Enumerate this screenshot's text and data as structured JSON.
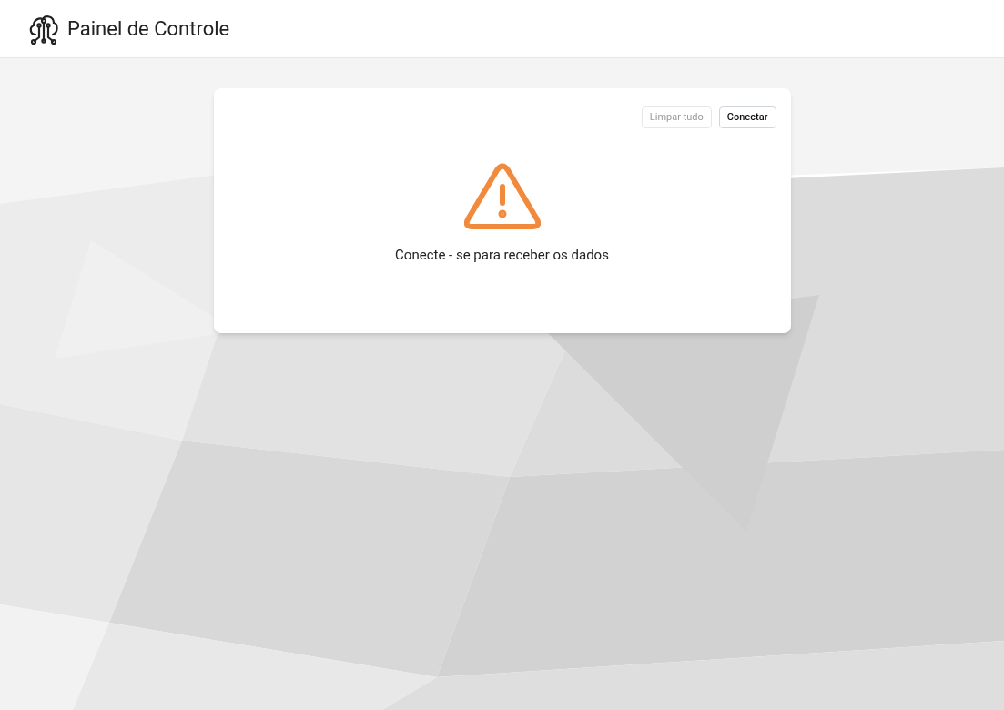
{
  "header": {
    "title": "Painel de Controle"
  },
  "card": {
    "buttons": [
      {
        "label": "Limpar tudo",
        "disabled": true
      },
      {
        "label": "Conectar",
        "disabled": false
      }
    ],
    "message": "Conecte - se para receber os dados"
  }
}
